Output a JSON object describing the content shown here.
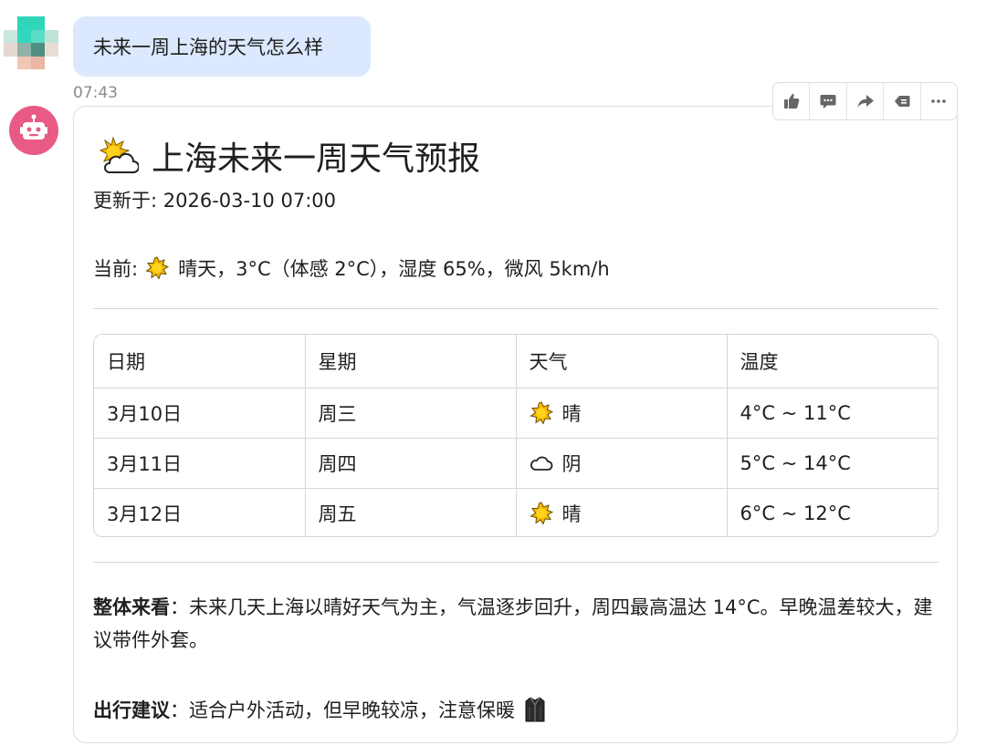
{
  "user_message": {
    "text": "未来一周上海的天气怎么样",
    "time": "07:43"
  },
  "toolbar": {
    "buttons": [
      {
        "icon": "thumbs-up-icon"
      },
      {
        "icon": "comment-icon"
      },
      {
        "icon": "share-icon"
      },
      {
        "icon": "copy-icon"
      },
      {
        "icon": "more-icon"
      }
    ]
  },
  "answer": {
    "title": "上海未来一周天气预报",
    "title_icon": "sun-behind-cloud-icon",
    "updated": "更新于: 2026-03-10 07:00",
    "current": {
      "label": "当前:",
      "icon": "sun-icon",
      "text": "晴天，3°C（体感 2°C），湿度 65%，微风 5km/h"
    },
    "table": {
      "headers": [
        "日期",
        "星期",
        "天气",
        "温度"
      ],
      "rows": [
        {
          "date": "3月10日",
          "weekday": "周三",
          "icon": "sun-icon",
          "weather": "晴",
          "temp": "4°C ~ 11°C"
        },
        {
          "date": "3月11日",
          "weekday": "周四",
          "icon": "cloud-icon",
          "weather": "阴",
          "temp": "5°C ~ 14°C"
        },
        {
          "date": "3月12日",
          "weekday": "周五",
          "icon": "sun-icon",
          "weather": "晴",
          "temp": "6°C ~ 12°C"
        }
      ]
    },
    "summary": {
      "label": "整体来看",
      "text": "：未来几天上海以晴好天气为主，气温逐步回升，周四最高温达 14°C。早晚温差较大，建议带件外套。"
    },
    "advice": {
      "label": "出行建议",
      "text": "：适合户外活动，但早晚较凉，注意保暖",
      "icon": "coat-icon"
    }
  },
  "colors": {
    "user_bubble": "#dbe8fd",
    "bot_avatar": "#e95a85",
    "border": "#dcdcdc",
    "sun": "#f5b800"
  }
}
